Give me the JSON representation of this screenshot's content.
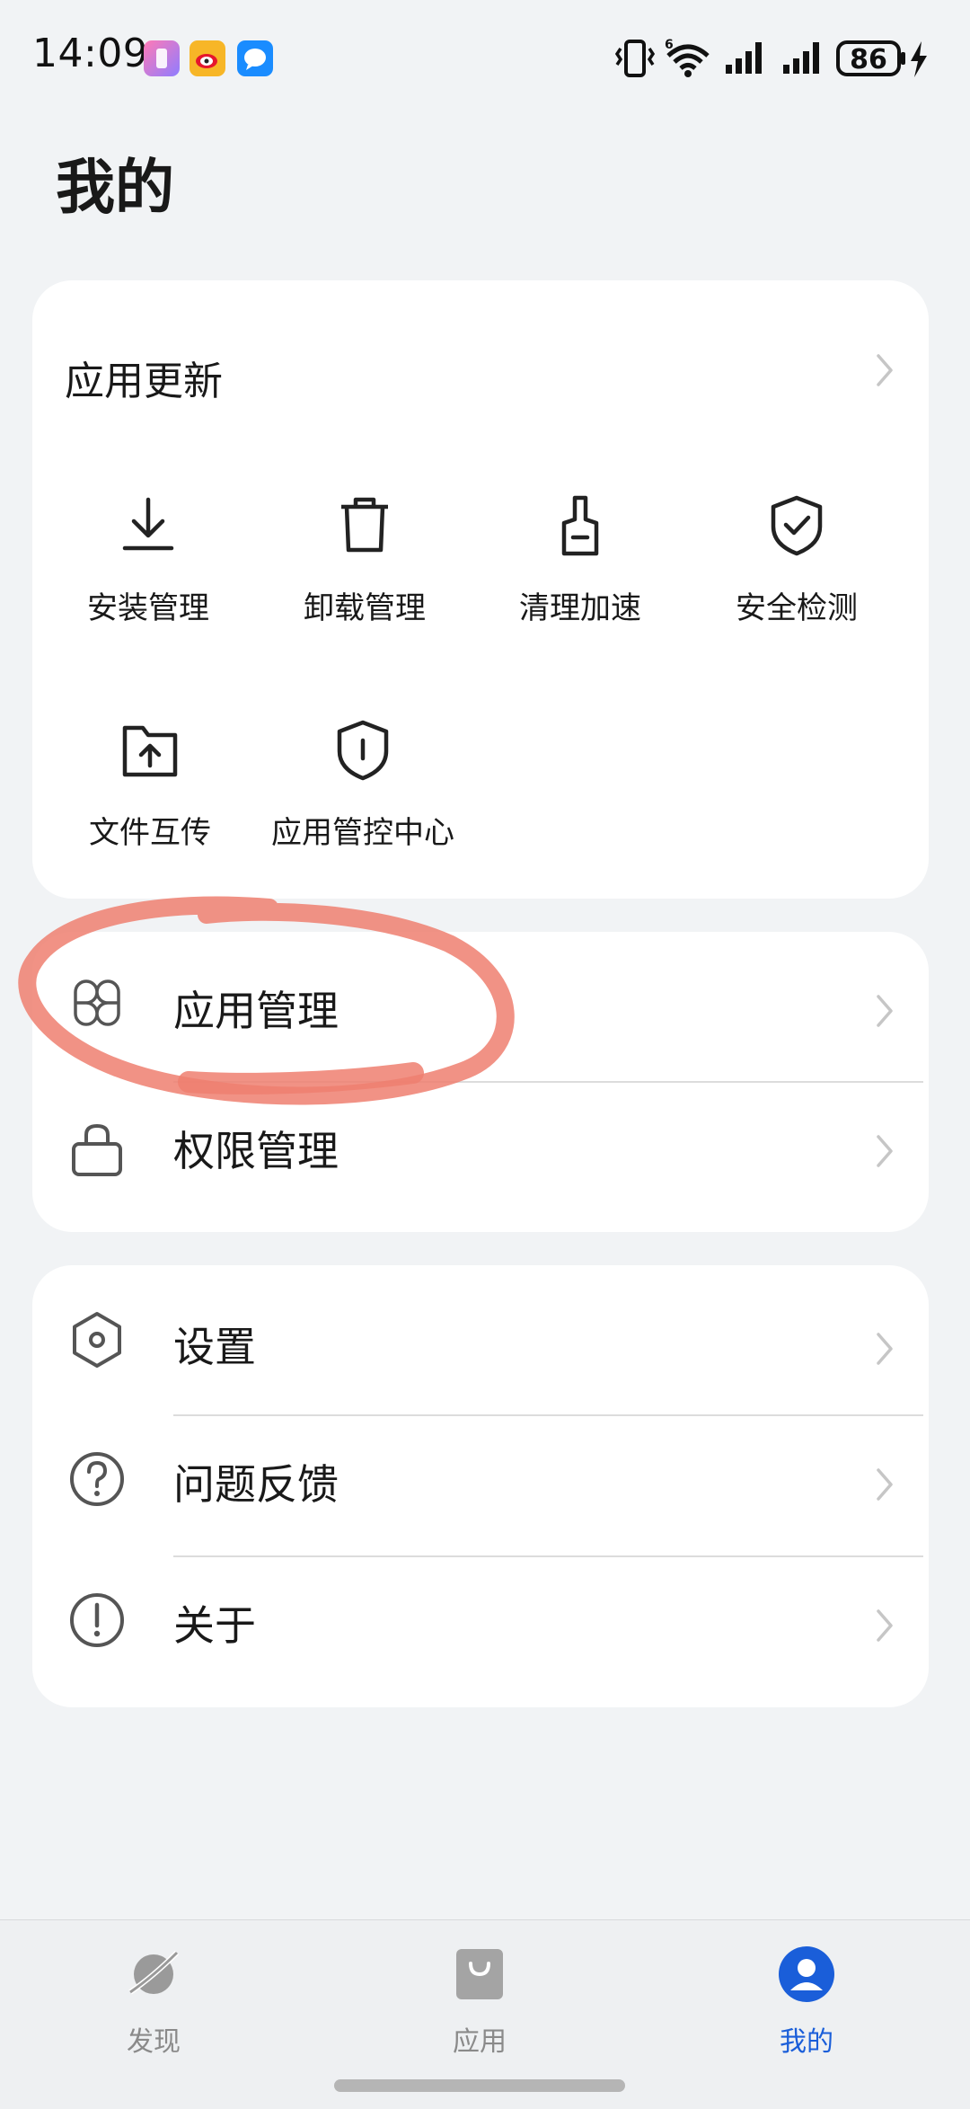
{
  "status_bar": {
    "time": "14:09",
    "battery": "86",
    "network_badge": "6"
  },
  "page": {
    "title": "我的"
  },
  "tools_card": {
    "update_label": "应用更新",
    "tools": [
      {
        "label": "安装管理",
        "icon": "download-icon"
      },
      {
        "label": "卸载管理",
        "icon": "trash-icon"
      },
      {
        "label": "清理加速",
        "icon": "brush-icon"
      },
      {
        "label": "安全检测",
        "icon": "shield-check-icon"
      },
      {
        "label": "文件互传",
        "icon": "folder-upload-icon"
      },
      {
        "label": "应用管控中心",
        "icon": "shield-alert-icon"
      }
    ]
  },
  "management_card": {
    "items": [
      {
        "label": "应用管理",
        "icon": "app-grid-icon"
      },
      {
        "label": "权限管理",
        "icon": "lock-icon"
      }
    ]
  },
  "more_card": {
    "items": [
      {
        "label": "设置",
        "icon": "hexagon-settings-icon"
      },
      {
        "label": "问题反馈",
        "icon": "question-icon"
      },
      {
        "label": "关于",
        "icon": "info-exclamation-icon"
      }
    ]
  },
  "bottom_nav": {
    "items": [
      {
        "label": "发现",
        "icon": "planet-icon",
        "active": false
      },
      {
        "label": "应用",
        "icon": "bag-icon",
        "active": false
      },
      {
        "label": "我的",
        "icon": "user-icon",
        "active": true
      }
    ]
  },
  "colors": {
    "accent": "#1a5ed9",
    "background": "#f1f3f5",
    "card": "#ffffff",
    "annotation": "#ee7f70"
  }
}
